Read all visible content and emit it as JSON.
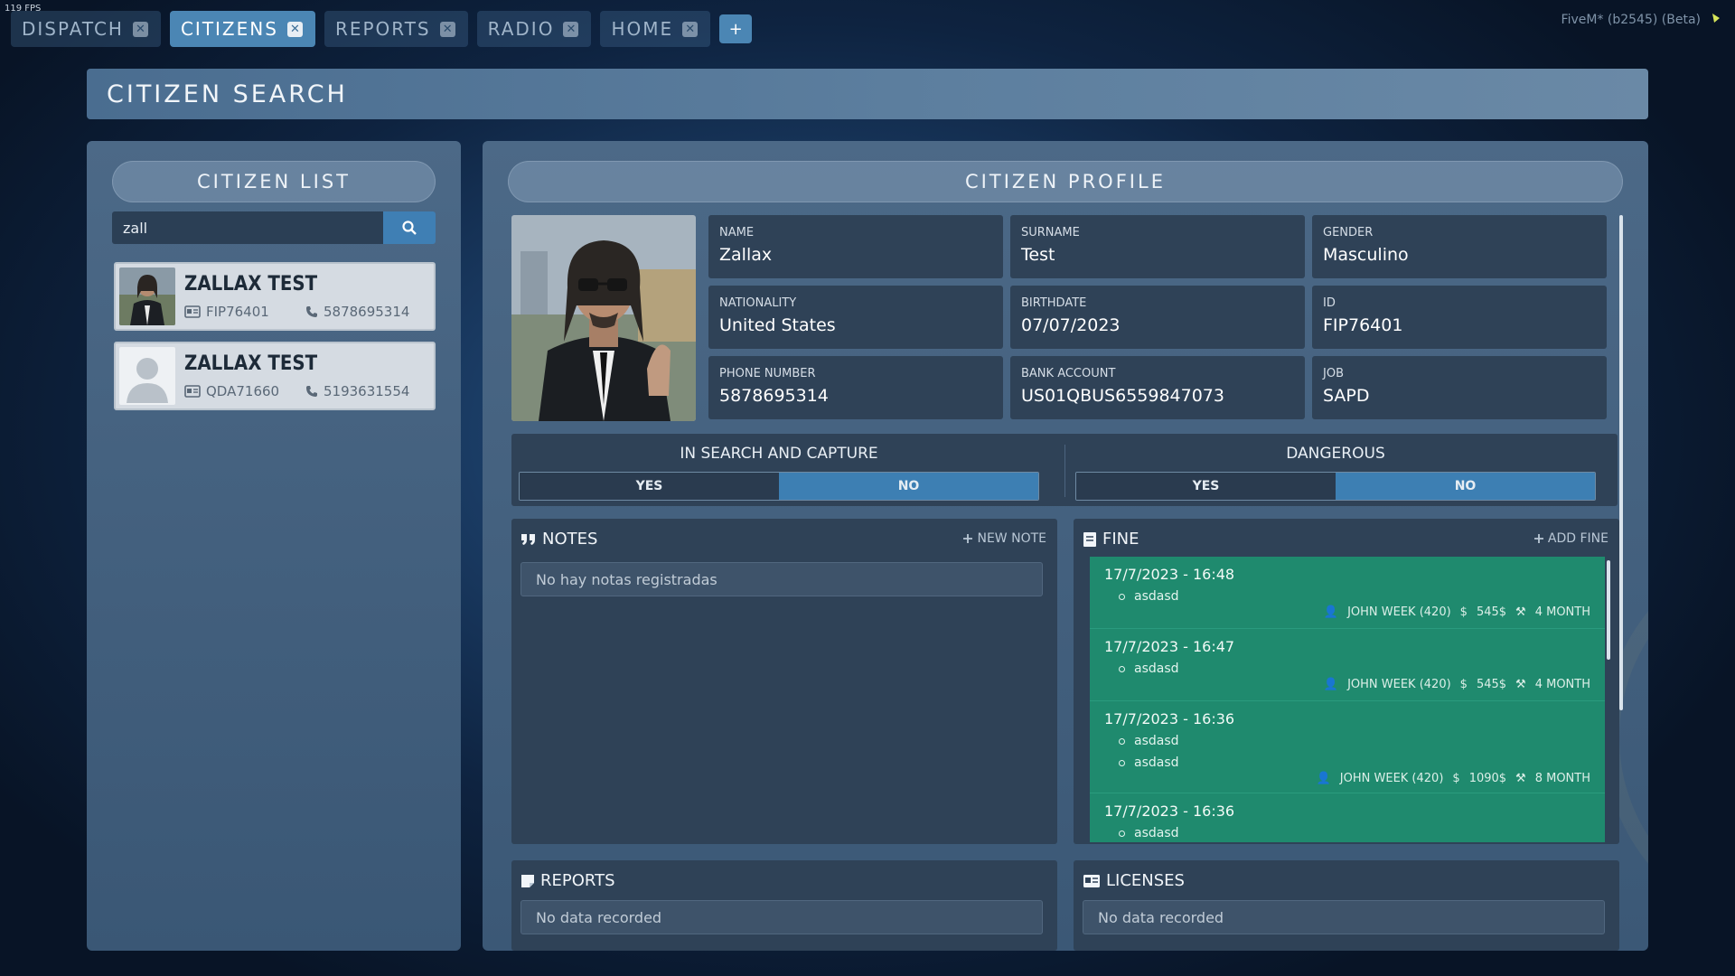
{
  "overlay": {
    "fps": "119 FPS",
    "fivem": "FiveM* (b2545) (Beta)"
  },
  "tabs": [
    {
      "label": "DISPATCH",
      "active": false
    },
    {
      "label": "CITIZENS",
      "active": true
    },
    {
      "label": "REPORTS",
      "active": false
    },
    {
      "label": "RADIO",
      "active": false
    },
    {
      "label": "HOME",
      "active": false
    }
  ],
  "tab_add": "+",
  "tab_close": "✕",
  "page_title": "CITIZEN SEARCH",
  "citizen_list": {
    "title": "CITIZEN LIST",
    "search_value": "zall",
    "items": [
      {
        "name": "ZALLAX TEST",
        "id": "FIP76401",
        "phone": "5878695314",
        "has_photo": true
      },
      {
        "name": "ZALLAX TEST",
        "id": "QDA71660",
        "phone": "5193631554",
        "has_photo": false
      }
    ]
  },
  "profile": {
    "title": "CITIZEN PROFILE",
    "fields": [
      {
        "label": "NAME",
        "value": "Zallax"
      },
      {
        "label": "SURNAME",
        "value": "Test"
      },
      {
        "label": "GENDER",
        "value": "Masculino"
      },
      {
        "label": "NATIONALITY",
        "value": "United States"
      },
      {
        "label": "BIRTHDATE",
        "value": "07/07/2023"
      },
      {
        "label": "ID",
        "value": "FIP76401"
      },
      {
        "label": "PHONE NUMBER",
        "value": "5878695314"
      },
      {
        "label": "BANK ACCOUNT",
        "value": "US01QBUS6559847073"
      },
      {
        "label": "JOB",
        "value": "SAPD"
      }
    ],
    "search_capture": {
      "title": "IN SEARCH AND CAPTURE",
      "yes": "YES",
      "no": "NO",
      "selected": "no"
    },
    "dangerous": {
      "title": "DANGEROUS",
      "yes": "YES",
      "no": "NO",
      "selected": "no"
    }
  },
  "notes": {
    "title": "NOTES",
    "action": "NEW NOTE",
    "empty": "No hay notas registradas"
  },
  "fine": {
    "title": "FINE",
    "action": "ADD FINE",
    "items": [
      {
        "date": "17/7/2023 - 16:48",
        "reasons": [
          "asdasd"
        ],
        "officer": "JOHN WEEK (420)",
        "amount": "545$",
        "time": "4 MONTH"
      },
      {
        "date": "17/7/2023 - 16:47",
        "reasons": [
          "asdasd"
        ],
        "officer": "JOHN WEEK (420)",
        "amount": "545$",
        "time": "4 MONTH"
      },
      {
        "date": "17/7/2023 - 16:36",
        "reasons": [
          "asdasd",
          "asdasd"
        ],
        "officer": "JOHN WEEK (420)",
        "amount": "1090$",
        "time": "8 MONTH"
      },
      {
        "date": "17/7/2023 - 16:36",
        "reasons": [
          "asdasd"
        ],
        "officer": "",
        "amount": "",
        "time": ""
      }
    ]
  },
  "reports": {
    "title": "REPORTS",
    "empty": "No data recorded"
  },
  "licenses": {
    "title": "LICENSES",
    "empty": "No data recorded"
  },
  "colors": {
    "accent": "#3d7fb3",
    "fine_bg": "#1f8a6e",
    "field_bg": "#2f4257"
  }
}
